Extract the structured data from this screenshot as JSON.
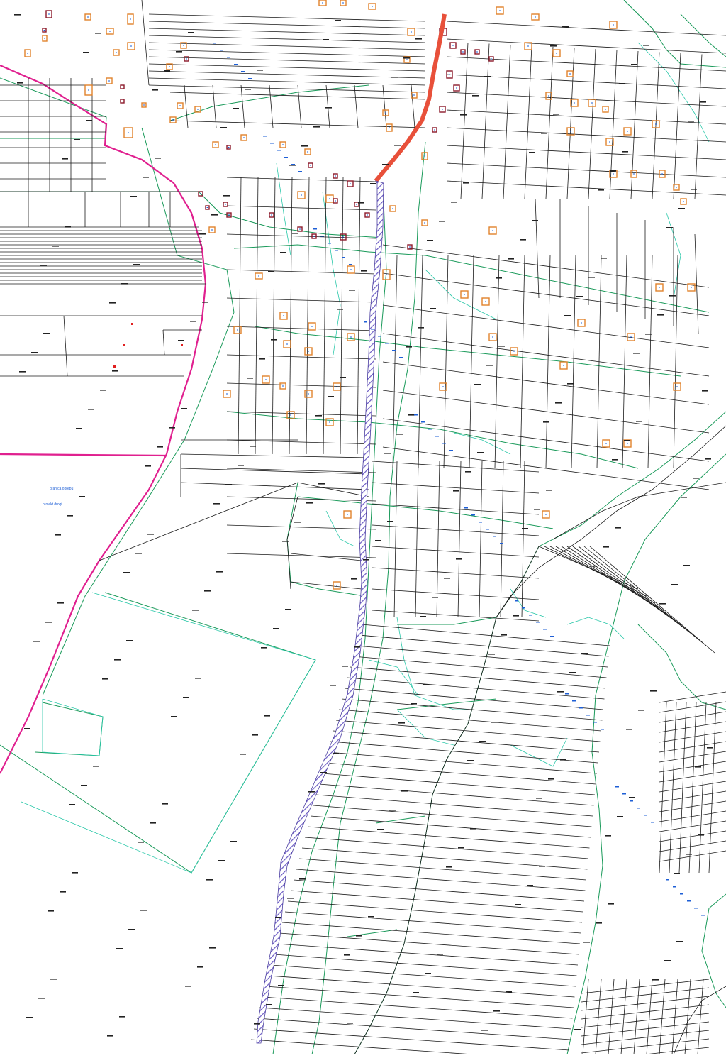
{
  "colors": {
    "background": "#ffffff",
    "parcel_line": "#1a1a1a",
    "boundary_green": "#1a9a5a",
    "contour_cyan": "#28c7a8",
    "municipal_boundary": "#e0208f",
    "building_orange": "#e0822c",
    "building_red": "#8b1a2b",
    "road_highlight": "#e8503a",
    "planned_route": "#6b5bc4",
    "label_blue": "#1e5fd6"
  },
  "map_labels": {
    "area_label_1": "granica obrębu",
    "area_label_2": "projekt drogi"
  },
  "legend_items": []
}
